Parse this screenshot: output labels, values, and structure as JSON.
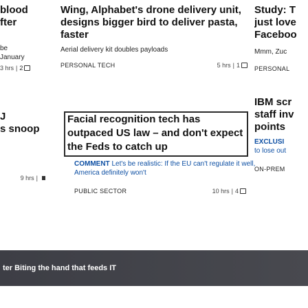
{
  "left_col": {
    "headline_lines": [
      "blood",
      "fter"
    ],
    "sub_lines": [
      "be",
      "January"
    ],
    "meta_time": "3 hrs",
    "meta_comments": "2",
    "lower_lines": [
      "J",
      "s snoop"
    ],
    "lower_meta_time": "9 hrs"
  },
  "mid_col": {
    "story1": {
      "headline": "Wing, Alphabet's drone delivery unit, designs bigger bird to deliver pasta, faster",
      "subhead": "Aerial delivery kit doubles payloads",
      "category": "PERSONAL TECH",
      "time": "5 hrs",
      "comments": "1"
    },
    "story2": {
      "headline_line1": "Facial recognition tech has",
      "headline_line2": "outpaced US law – and don't expect",
      "headline_line3": "the Feds to catch up",
      "kick": "COMMENT",
      "lede": "Let's be realistic: If the EU can't regulate it well, America definitely won't",
      "category": "PUBLIC SECTOR",
      "time": "10 hrs",
      "comments": "4"
    }
  },
  "right_col": {
    "story1": {
      "headline_lines": [
        "Study: T",
        "just love",
        "Faceboo"
      ],
      "subhead": "Mmm, Zuc",
      "category": "PERSONAL"
    },
    "story2": {
      "headline_lines": [
        "IBM scr",
        "staff inv",
        "points"
      ],
      "lede_kick": "EXCLUSI",
      "lede_lines": [
        "to lose out"
      ],
      "category": "ON-PREM"
    }
  },
  "video_bar": {
    "text": "ter  Biting the hand that feeds IT"
  },
  "colors": {
    "link_blue": "#0d4fa3",
    "bar_bg": "#3d3e45",
    "text": "#111111"
  }
}
